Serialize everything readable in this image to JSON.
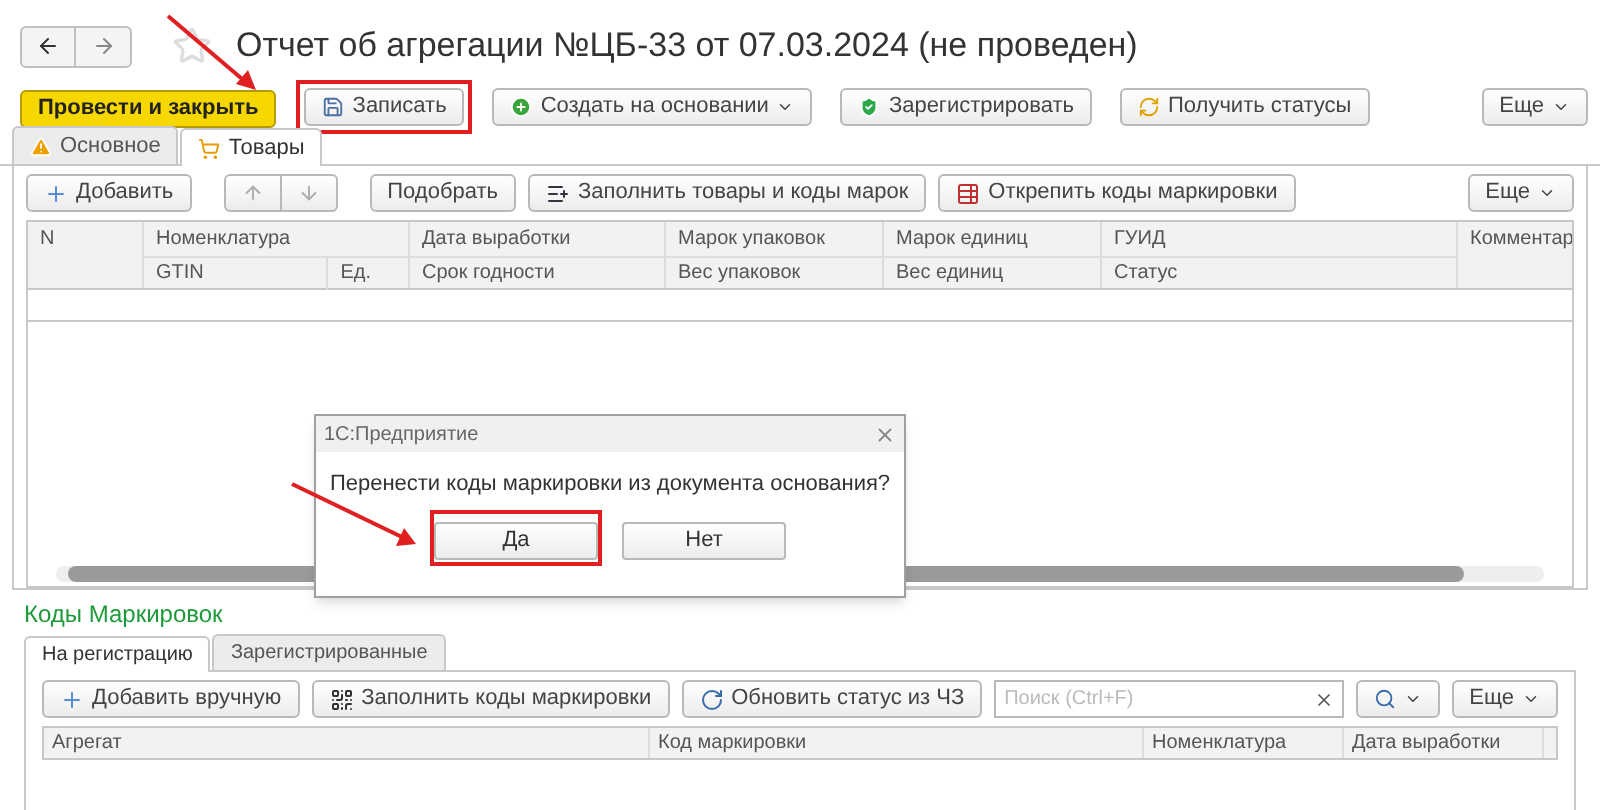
{
  "title": "Отчет об агрегации №ЦБ-33 от 07.03.2024 (не проведен)",
  "toolbar": [
    {
      "label": "Провести и закрыть",
      "kind": "primary",
      "annotated": false
    },
    {
      "label": "Записать",
      "kind": "plain",
      "annotated": true
    },
    {
      "label": "Создать на основании",
      "kind": "menu",
      "annotated": false
    },
    {
      "label": "Зарегистрировать",
      "kind": "plain",
      "annotated": false
    },
    {
      "label": "Получить статусы",
      "kind": "plain",
      "annotated": false
    }
  ],
  "toolbar_more": "Еще",
  "tabs": [
    {
      "label": "Основное",
      "selected": false
    },
    {
      "label": "Товары",
      "selected": true
    }
  ],
  "goods_toolbar": [
    {
      "label": "Добавить"
    },
    {
      "label": "Подобрать"
    },
    {
      "label": "Заполнить товары и коды марок"
    },
    {
      "label": "Открепить коды маркировки"
    }
  ],
  "goods_more": "Еще",
  "goods_table": {
    "columns": [
      {
        "label": "N"
      },
      {
        "label": "Номенклатура",
        "sub": [
          "GTIN",
          "Ед."
        ]
      },
      {
        "label": "Дата выработки",
        "sub": [
          "Срок годности"
        ]
      },
      {
        "label": "Марок упаковок",
        "sub": [
          "Вес упаковок"
        ]
      },
      {
        "label": "Марок единиц",
        "sub": [
          "Вес единиц"
        ]
      },
      {
        "label": "ГУИД",
        "sub": [
          "Статус"
        ]
      },
      {
        "label": "Комментар"
      }
    ]
  },
  "dialog": {
    "title": "1С:Предприятие",
    "message": "Перенести коды маркировки из документа основания?",
    "buttons": [
      {
        "label": "Да",
        "annotated": true
      },
      {
        "label": "Нет",
        "annotated": false
      }
    ]
  },
  "codes_section": {
    "title": "Коды Маркировок",
    "tabs": [
      {
        "label": "На регистрацию",
        "selected": true
      },
      {
        "label": "Зарегистрированные",
        "selected": false
      }
    ],
    "toolbar": [
      {
        "label": "Добавить вручную"
      },
      {
        "label": "Заполнить коды маркировки"
      },
      {
        "label": "Обновить статус из ЧЗ"
      }
    ],
    "search": {
      "placeholder": "Поиск (Ctrl+F)"
    },
    "more": "Еще",
    "columns": [
      "Агрегат",
      "Код маркировки",
      "Номенклатура",
      "Дата выработки"
    ]
  }
}
